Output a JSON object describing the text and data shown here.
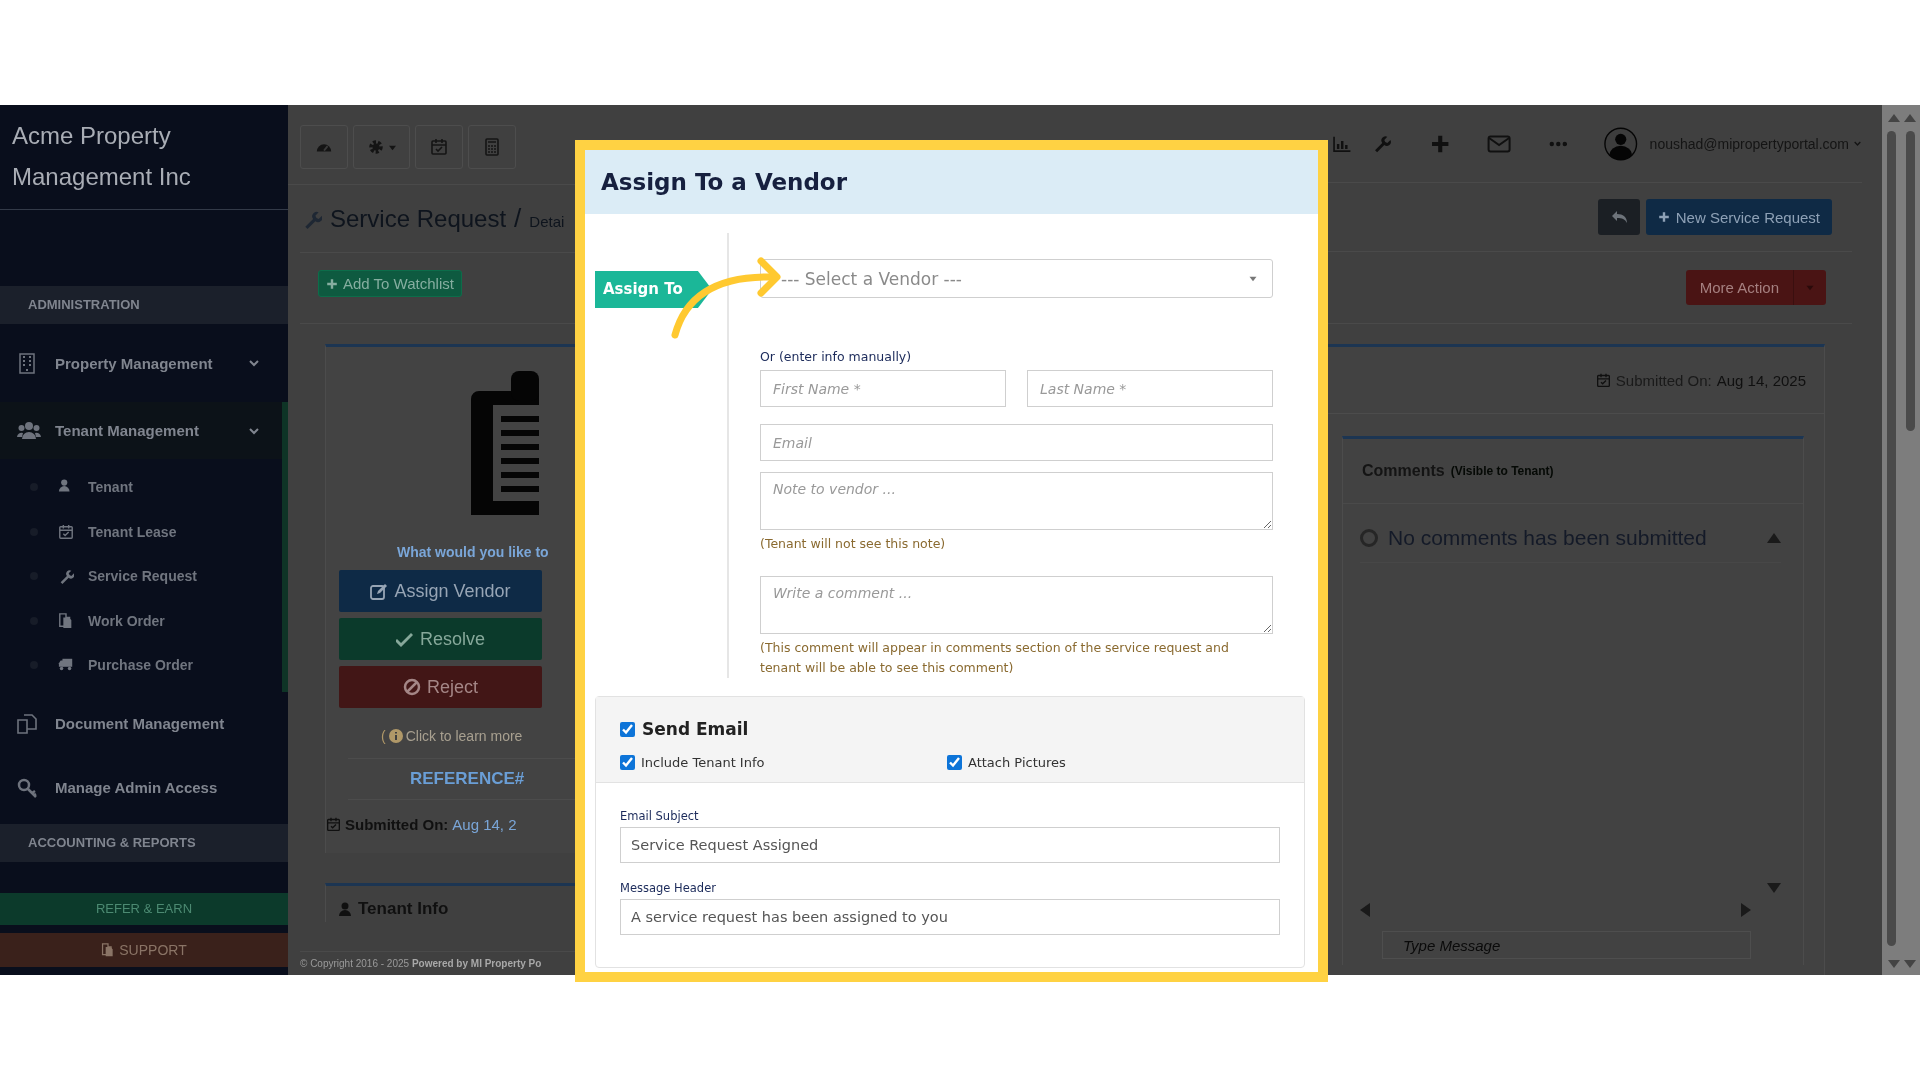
{
  "sidebar": {
    "brand": "Acme Property Management Inc",
    "items": [
      {
        "kind": "section",
        "label": "ADMINISTRATION"
      },
      {
        "kind": "menu",
        "label": "Property Management",
        "selected": false
      },
      {
        "kind": "menu",
        "label": "Tenant Management",
        "selected": true,
        "children": [
          {
            "label": "Tenant"
          },
          {
            "label": "Tenant Lease"
          },
          {
            "label": "Service Request"
          },
          {
            "label": "Work Order"
          },
          {
            "label": "Purchase Order"
          }
        ]
      },
      {
        "kind": "link",
        "label": "Document Management",
        "selected": false
      },
      {
        "kind": "link",
        "label": "Manage Admin Access",
        "selected": false
      },
      {
        "kind": "section",
        "label": "ACCOUNTING & REPORTS"
      }
    ],
    "refer_button": "REFER & EARN",
    "support_button": "SUPPORT"
  },
  "user": {
    "email": "noushad@mipropertyportal.com"
  },
  "page": {
    "title": "Service Request",
    "separator": "/",
    "subtitle": "Detai",
    "watchlist_button": "Add To Watchlist",
    "new_button": "New Service Request",
    "more_action_button": "More Action"
  },
  "request_card": {
    "prompt": "What would you like to",
    "actions": [
      {
        "kind": "assign",
        "label": "Assign Vendor"
      },
      {
        "kind": "resolve",
        "label": "Resolve"
      },
      {
        "kind": "reject",
        "label": "Reject"
      }
    ],
    "learn_more_open": "(",
    "learn_more": "Click to learn more",
    "reference": "REFERENCE#",
    "submitted_label": "Submitted On:",
    "submitted_value": "Aug 14, 2"
  },
  "tenant_info_title": "Tenant Info",
  "detail_card": {
    "submitted_label": "Submitted On:",
    "submitted_value": "Aug 14, 2025"
  },
  "comments": {
    "title": "Comments",
    "note": "(Visible to Tenant)",
    "empty": "No comments has been submitted",
    "message": {
      "placeholder": "Type Message"
    }
  },
  "footer": {
    "copyright": "© Copyright 2016 - 2025 **Powered by MI Property Po**"
  },
  "modal": {
    "title": "Assign To a Vendor",
    "assign_tag": "Assign To",
    "vendor_select": {
      "placeholder": "--- Select a Vendor ---"
    },
    "manual_label": "Or (enter info manually)",
    "first_name": {
      "placeholder": "First Name *"
    },
    "last_name": {
      "placeholder": "Last Name *"
    },
    "email": {
      "placeholder": "Email"
    },
    "note": {
      "placeholder": "Note to vendor ..."
    },
    "note_help": "(Tenant will not see this note)",
    "comment": {
      "placeholder": "Write a comment ..."
    },
    "comment_help": "(This comment will appear in comments section of the service request and tenant will be able to see this comment)",
    "send_email": {
      "label": "Send Email",
      "checked": true
    },
    "options": [
      {
        "label": "Include Tenant Info",
        "checked": true
      },
      {
        "label": "Attach Pictures",
        "checked": true
      }
    ],
    "email_subject": {
      "label": "Email Subject",
      "value": "Service Request Assigned"
    },
    "message_header": {
      "label": "Message Header",
      "value": "A service request has been assigned to you"
    }
  }
}
